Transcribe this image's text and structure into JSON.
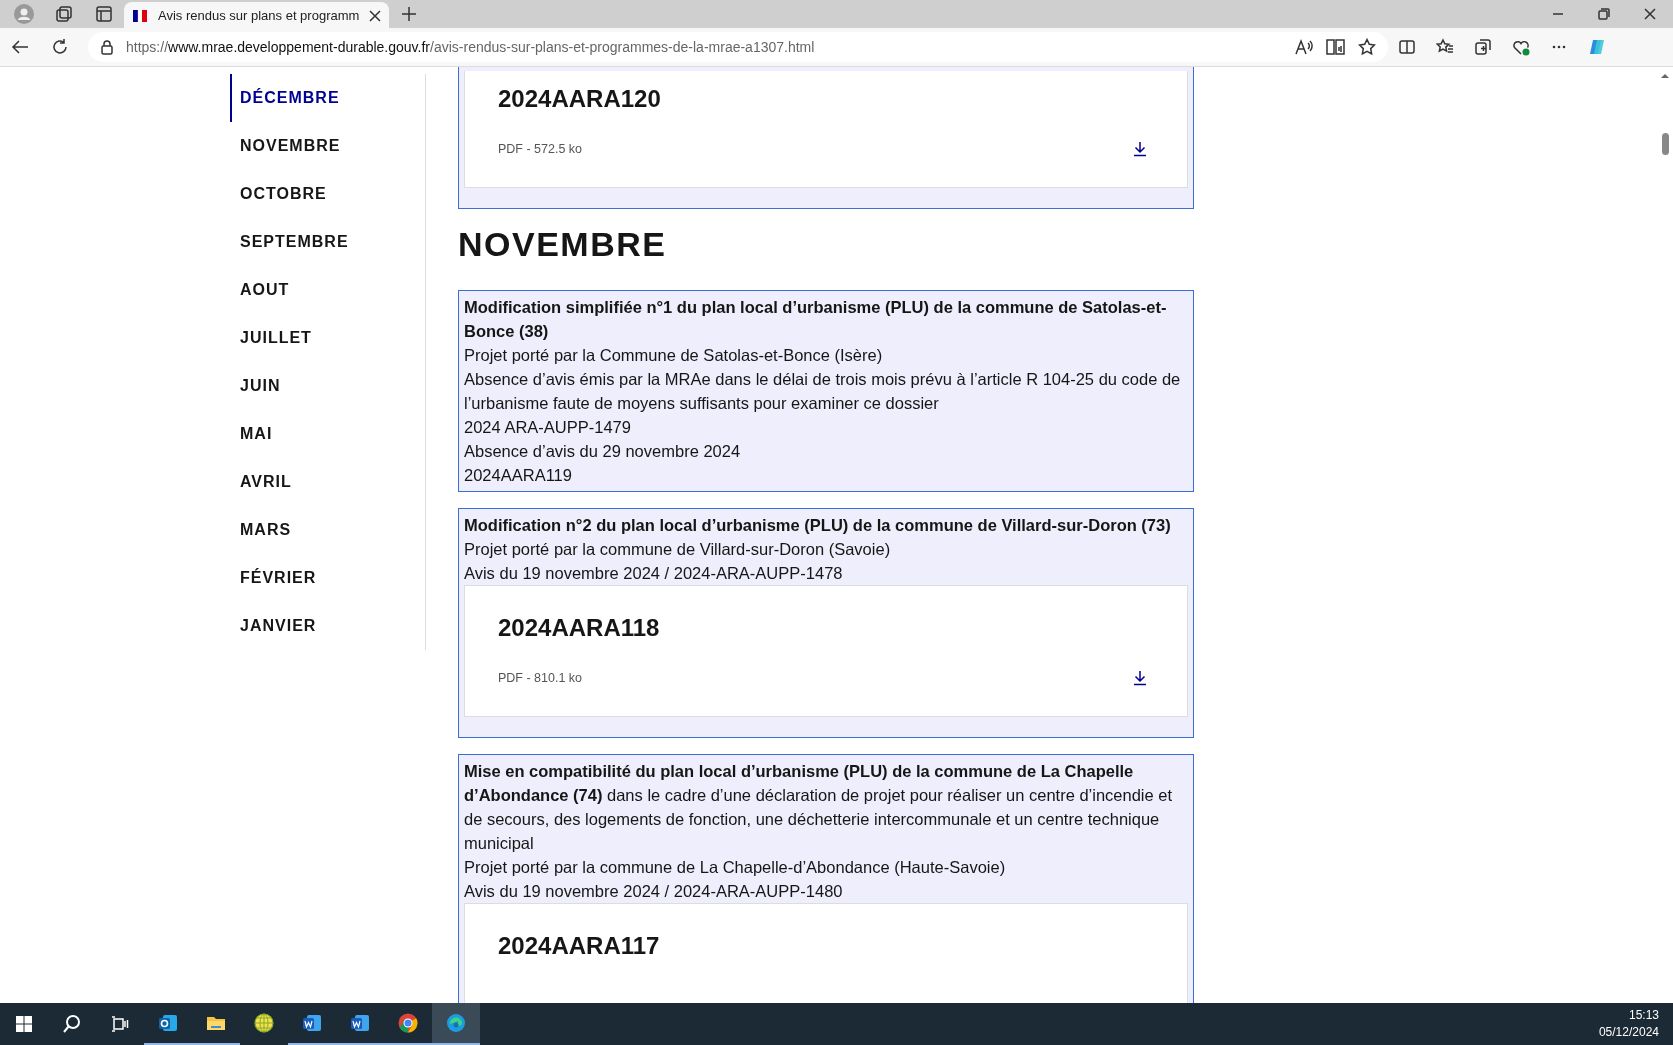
{
  "browser": {
    "tabs": [
      {
        "title": "Avis rendus sur plans et programm",
        "selected": true
      }
    ],
    "url": {
      "scheme": "https://",
      "host": "www.mrae.developpement-durable.gouv.fr",
      "path": "/avis-rendus-sur-plans-et-programmes-de-la-mrae-a1307.html"
    }
  },
  "sidebar": {
    "items": [
      {
        "label": "DÉCEMBRE",
        "selected": true
      },
      {
        "label": "NOVEMBRE",
        "selected": false
      },
      {
        "label": "OCTOBRE",
        "selected": false
      },
      {
        "label": "SEPTEMBRE",
        "selected": false
      },
      {
        "label": "AOUT",
        "selected": false
      },
      {
        "label": "JUILLET",
        "selected": false
      },
      {
        "label": "JUIN",
        "selected": false
      },
      {
        "label": "MAI",
        "selected": false
      },
      {
        "label": "AVRIL",
        "selected": false
      },
      {
        "label": "MARS",
        "selected": false
      },
      {
        "label": "FÉVRIER",
        "selected": false
      },
      {
        "label": "JANVIER",
        "selected": false
      }
    ]
  },
  "content": [
    {
      "kind": "continued",
      "document": {
        "title": "2024AARA120",
        "meta": "PDF - 572.5 ko"
      }
    },
    {
      "kind": "heading",
      "text": "NOVEMBRE"
    },
    {
      "kind": "entry",
      "title": "**Modification simplifiée n°1 du plan local d’urbanisme (PLU) de la commune de Satolas-et-Bonce (38)**",
      "lines": [
        "Projet porté par la Commune de Satolas-et-Bonce (Isère)",
        "Absence d’avis émis par la MRAe dans le délai de trois mois prévu à l’article R 104-25 du code de l’urbanisme faute de moyens suffisants pour examiner ce dossier",
        "2024 ARA-AUPP-1479",
        "Absence d’avis du 29 novembre 2024",
        "2024AARA119"
      ]
    },
    {
      "kind": "entry",
      "title": "**Modification n°2 du plan local d’urbanisme (PLU) de la commune de Villard-sur-Doron (73)**",
      "lines": [
        "Projet porté par la commune de Villard-sur-Doron (Savoie)",
        "Avis du 19 novembre 2024 / 2024-ARA-AUPP-1478"
      ],
      "document": {
        "title": "2024AARA118",
        "meta": "PDF - 810.1 ko"
      }
    },
    {
      "kind": "entry",
      "title": "**Mise en compatibilité du plan local d’urbanisme (PLU) de la commune de La Chapelle d’Abondance (74)** dans le cadre d’une déclaration de projet pour réaliser un centre d’incendie et de secours, des logements de fonction, une déchetterie intercommunale et un centre technique municipal",
      "lines": [
        "Projet porté par la commune de La Chapelle-d’Abondance (Haute-Savoie)",
        "Avis du 19 novembre 2024 / 2024-ARA-AUPP-1480"
      ],
      "document": {
        "title": "2024AARA117"
      }
    }
  ],
  "taskbar": {
    "apps": [
      {
        "kind": "outlook",
        "running": true,
        "active": false
      },
      {
        "kind": "explorer",
        "running": true,
        "active": false
      },
      {
        "kind": "globe",
        "running": false,
        "active": false
      },
      {
        "kind": "word",
        "running": true,
        "active": false
      },
      {
        "kind": "word",
        "running": true,
        "active": false
      },
      {
        "kind": "chrome",
        "running": true,
        "active": false
      },
      {
        "kind": "edge",
        "running": true,
        "active": true
      }
    ],
    "time": "15:13",
    "date": "05/12/2024"
  }
}
